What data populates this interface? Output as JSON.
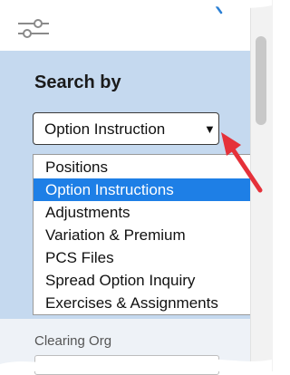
{
  "panel": {
    "heading": "Search by",
    "select": {
      "value": "Option Instruction",
      "caret": "▼"
    },
    "dropdown": {
      "options": [
        "Positions",
        "Option Instructions",
        "Adjustments",
        "Variation & Premium",
        "PCS Files",
        "Spread Option Inquiry",
        "Exercises & Assignments"
      ],
      "selected_index": 1
    }
  },
  "lower": {
    "clearing_label": "Clearing Org"
  },
  "icons": {
    "filter": "filter-sliders-icon",
    "annotation": "red-arrow-icon"
  },
  "colors": {
    "panel_bg": "#c5d9ef",
    "selected_bg": "#1e7fe6",
    "annotation": "#e5313a"
  }
}
